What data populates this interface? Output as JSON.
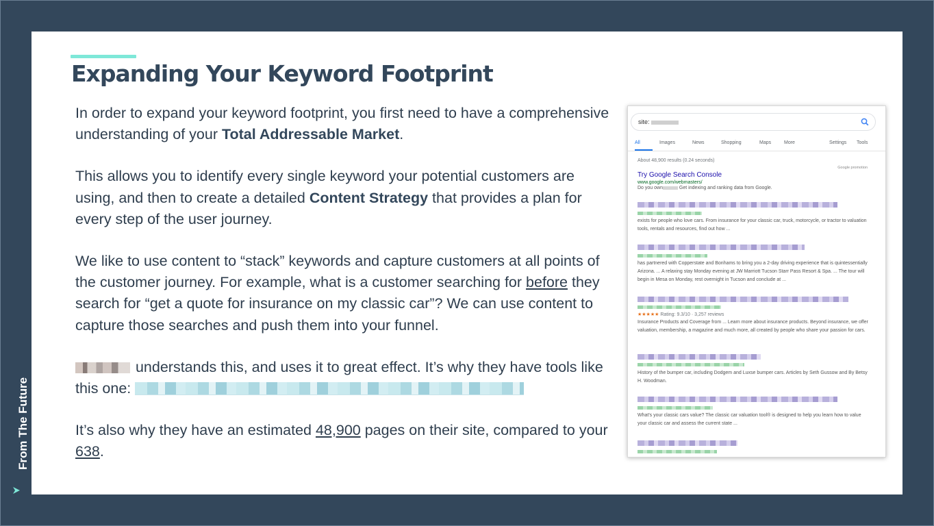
{
  "slide": {
    "title": "Expanding Your Keyword Footprint",
    "p1": {
      "pre": "In order to expand your keyword footprint, you first need to have a comprehensive understanding of your ",
      "bold": "Total Addressable Market",
      "post": "."
    },
    "p2": {
      "pre": "This allows you to identify every single keyword your potential customers are using, and then to create a detailed ",
      "bold": "Content Strategy",
      "post": " that provides a plan for every step of the user journey."
    },
    "p3": {
      "pre": "We like to use content to “stack” keywords and capture customers at all points of the customer journey. For example, what is a customer searching for ",
      "underline": "before",
      "post": " they search for “get a quote for insurance on my classic car”? We can use content to capture those searches and push them into your funnel."
    },
    "p4": {
      "post": " understands this, and uses it to great effect. It’s why they have tools like this one: "
    },
    "p5": {
      "pre": "It’s also why they have an estimated ",
      "u1": "48,900",
      "mid": " pages on their site, compared to your ",
      "u2": "638",
      "post": "."
    }
  },
  "serp": {
    "query": "site:",
    "tabs": [
      "All",
      "Images",
      "News",
      "Shopping",
      "Maps",
      "More",
      "Settings",
      "Tools"
    ],
    "stats": "About 48,900 results (0.24 seconds)",
    "promo": "Google promotion",
    "ad": {
      "title": "Try Google Search Console",
      "url": "www.google.com/webmasters/",
      "desc_pre": "Do you own",
      "desc_post": " Get indexing and ranking data from Google."
    },
    "results": [
      {
        "desc": "exists for people who love cars. From insurance for your classic car, truck, motorcycle, or tractor to valuation tools, rentals and resources, find out how ..."
      },
      {
        "desc": "has partnered with Copperstate and Bonhams to bring you a 2-day driving experience that is quintessentially Arizona. ... A relaxing stay Monday evening at JW Marriott Tucson Starr Pass Resort & Spa. ... The tour will begin in Mesa on Monday, rest overnight in Tucson and conclude at ..."
      },
      {
        "rating": "Rating: 9.3/10 · 3,257 reviews",
        "desc": "Insurance Products and Coverage from ... Learn more about insurance products. Beyond insurance, we offer valuation, membership, a magazine and much more, all created by people who share your passion for cars."
      },
      {
        "desc": "History of the bumper car, including Dodgem and Luxse bumper cars. Articles by Seth Gussow and By Betsy H. Woodman."
      },
      {
        "desc": "What's your classic cars value? The classic car valuation tool® is designed to help you learn how to value your classic car and assess the current state ..."
      }
    ]
  },
  "sidebar": {
    "label": "From The Future"
  },
  "colors": {
    "background": "#33475b",
    "accent": "#7ee8d8",
    "text": "#2f3e4e",
    "link_blue": "#1a0dab"
  }
}
